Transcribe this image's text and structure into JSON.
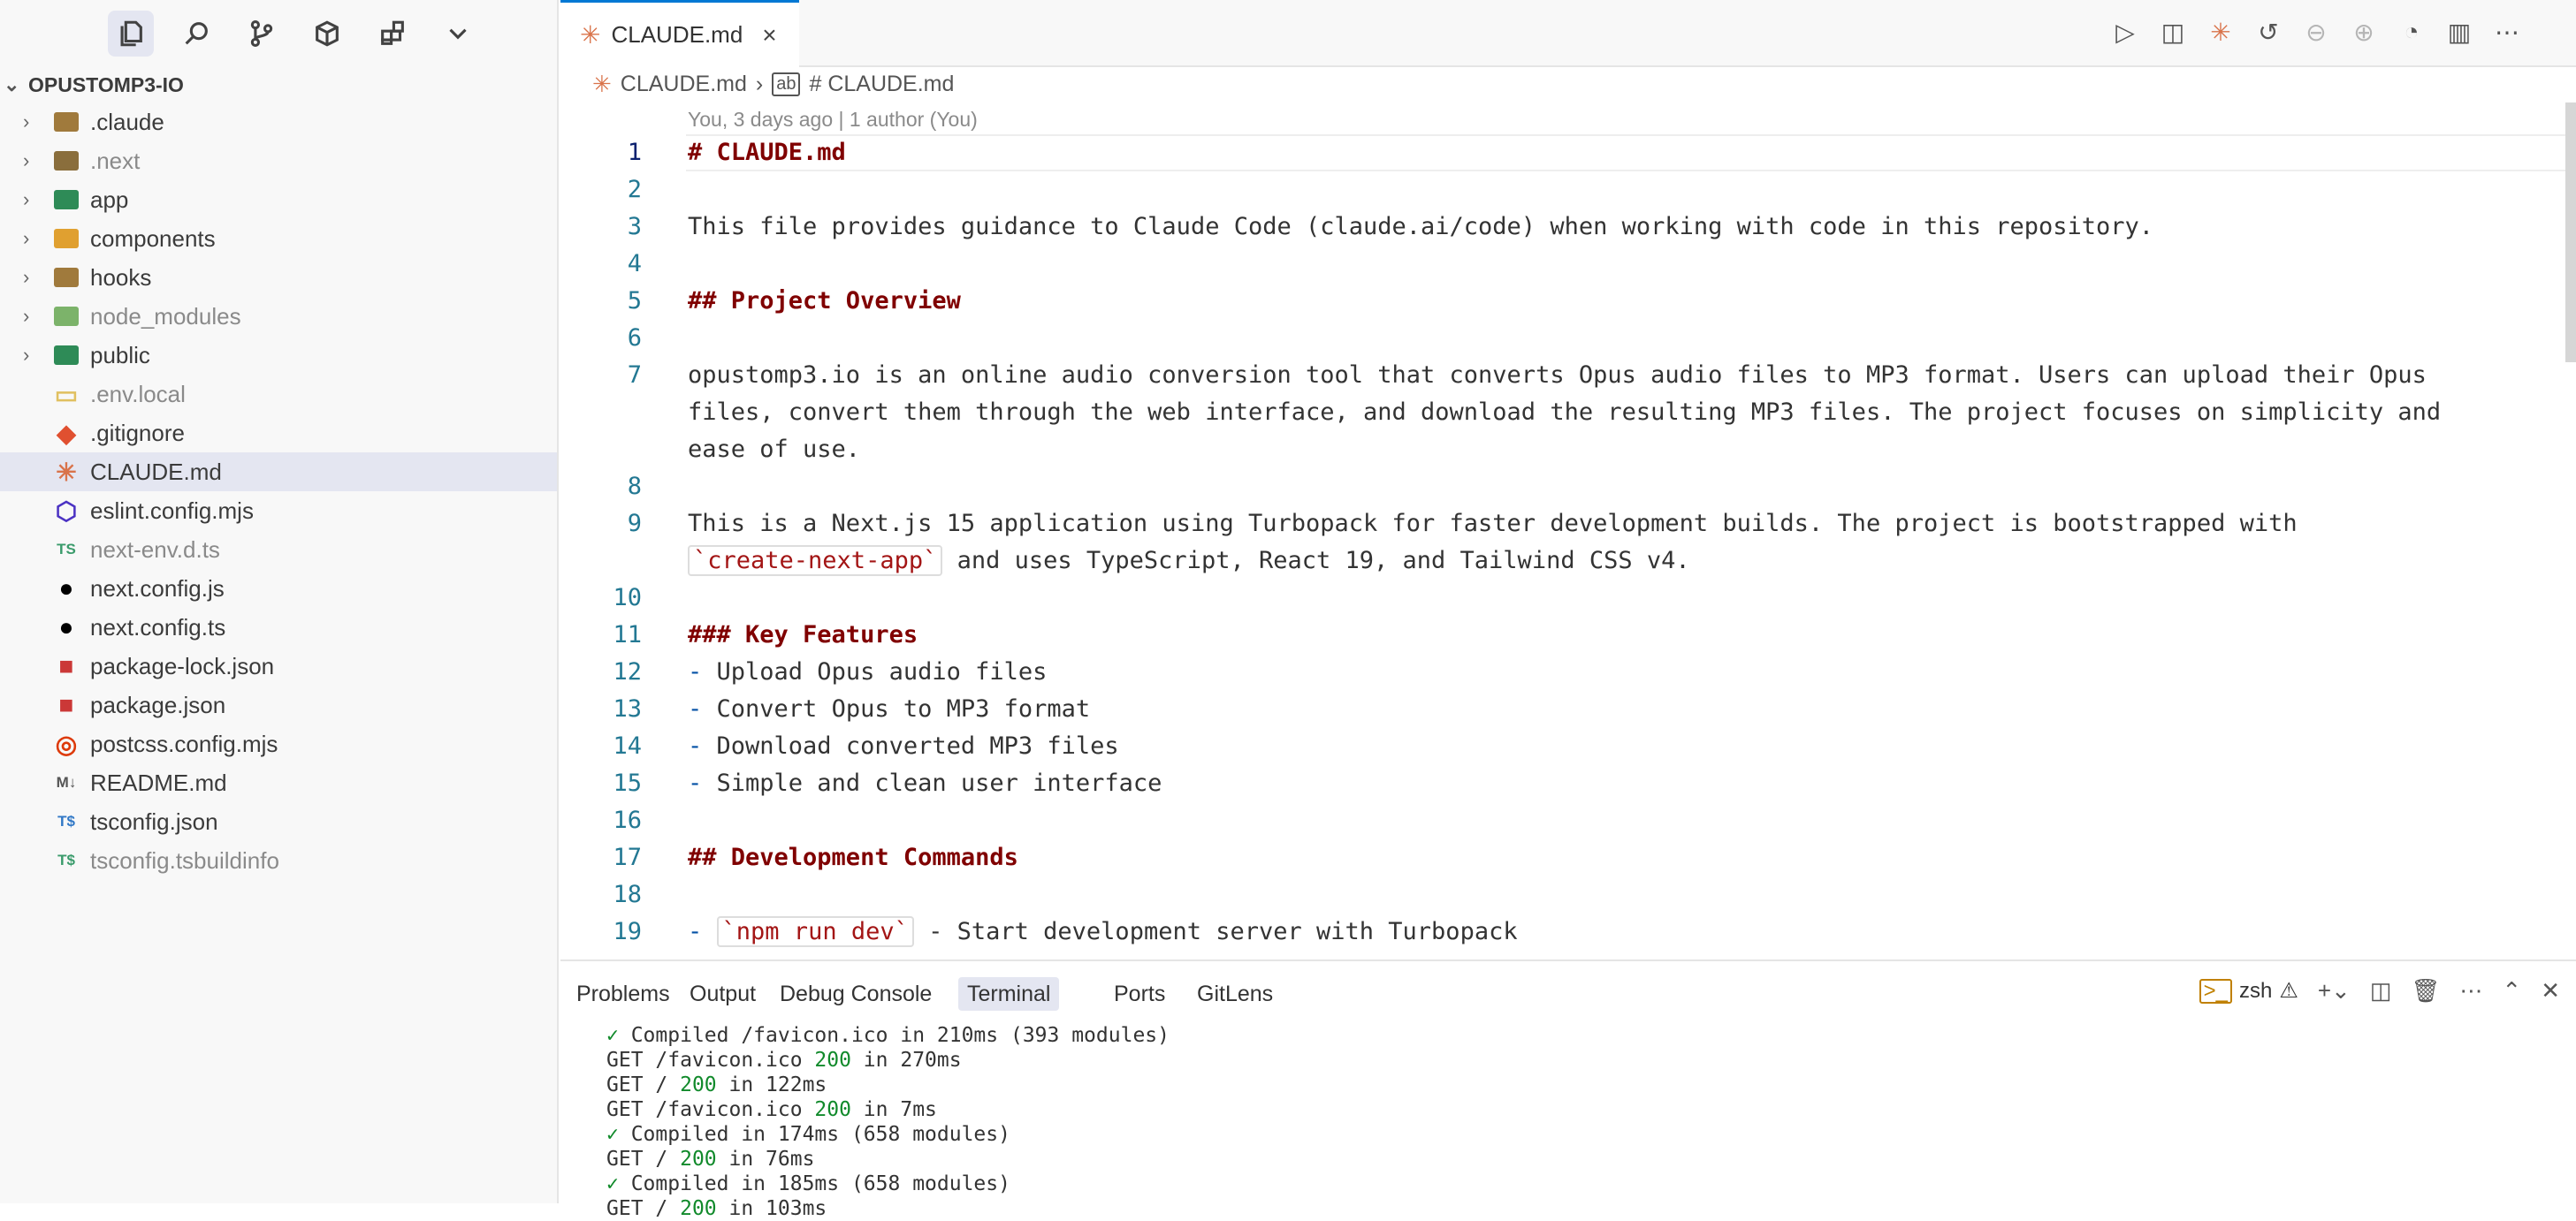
{
  "explorer": {
    "project": "OPUSTOMP3-IO",
    "items": [
      {
        "label": ".claude",
        "icon": "folder-claude-icon",
        "folder": true,
        "dim": false,
        "color": "#a07a3c"
      },
      {
        "label": ".next",
        "icon": "folder-next-icon",
        "folder": true,
        "dim": true,
        "color": "#8a6e3c"
      },
      {
        "label": "app",
        "icon": "folder-app-icon",
        "folder": true,
        "dim": false,
        "color": "#2e8b57"
      },
      {
        "label": "components",
        "icon": "folder-components-icon",
        "folder": true,
        "dim": false,
        "color": "#e0a030"
      },
      {
        "label": "hooks",
        "icon": "folder-hooks-icon",
        "folder": true,
        "dim": false,
        "color": "#a07a3c"
      },
      {
        "label": "node_modules",
        "icon": "folder-node-icon",
        "folder": true,
        "dim": true,
        "color": "#7cb36a"
      },
      {
        "label": "public",
        "icon": "folder-public-icon",
        "folder": true,
        "dim": false,
        "color": "#2e8b57"
      },
      {
        "label": ".env.local",
        "icon": "env-file-icon",
        "folder": false,
        "dim": true,
        "color": "#e0c060"
      },
      {
        "label": ".gitignore",
        "icon": "git-file-icon",
        "folder": false,
        "dim": false,
        "color": "#e05030"
      },
      {
        "label": "CLAUDE.md",
        "icon": "claude-file-icon",
        "folder": false,
        "dim": false,
        "color": "#d9734a"
      },
      {
        "label": "eslint.config.mjs",
        "icon": "eslint-file-icon",
        "folder": false,
        "dim": false,
        "color": "#4b32c3"
      },
      {
        "label": "next-env.d.ts",
        "icon": "ts-file-icon",
        "folder": false,
        "dim": true,
        "color": "#3a9b6b"
      },
      {
        "label": "next.config.js",
        "icon": "nextjs-file-icon",
        "folder": false,
        "dim": false,
        "color": "#000000"
      },
      {
        "label": "next.config.ts",
        "icon": "nextjs-file-icon",
        "folder": false,
        "dim": false,
        "color": "#000000"
      },
      {
        "label": "package-lock.json",
        "icon": "npm-file-icon",
        "folder": false,
        "dim": false,
        "color": "#cb3837"
      },
      {
        "label": "package.json",
        "icon": "npm-file-icon",
        "folder": false,
        "dim": false,
        "color": "#cb3837"
      },
      {
        "label": "postcss.config.mjs",
        "icon": "postcss-file-icon",
        "folder": false,
        "dim": false,
        "color": "#dd3a0a"
      },
      {
        "label": "README.md",
        "icon": "markdown-file-icon",
        "folder": false,
        "dim": false,
        "color": "#555555"
      },
      {
        "label": "tsconfig.json",
        "icon": "tsconfig-file-icon",
        "folder": false,
        "dim": false,
        "color": "#3178c6"
      },
      {
        "label": "tsconfig.tsbuildinfo",
        "icon": "tsconfig-file-icon",
        "folder": false,
        "dim": true,
        "color": "#3a9b6b"
      }
    ],
    "selected_index": 9
  },
  "tab": {
    "label": "CLAUDE.md",
    "close": "×"
  },
  "breadcrumb": {
    "file": "CLAUDE.md",
    "sep": "›",
    "symbol": "# CLAUDE.md"
  },
  "blame": "You, 3 days ago | 1 author (You)",
  "editor": {
    "lines": [
      {
        "n": "1",
        "html": "<span class=\"h\"># CLAUDE.md</span>"
      },
      {
        "n": "2",
        "html": ""
      },
      {
        "n": "3",
        "html": "This file provides guidance to Claude Code (claude.ai/code) when working with code in this repository."
      },
      {
        "n": "4",
        "html": ""
      },
      {
        "n": "5",
        "html": "<span class=\"h\">## Project Overview</span>"
      },
      {
        "n": "6",
        "html": ""
      },
      {
        "n": "7",
        "html": "opustomp3.io is an online audio conversion tool that converts Opus audio files to MP3 format. Users can upload their Opus"
      },
      {
        "n": "",
        "html": "files, convert them through the web interface, and download the resulting MP3 files. The project focuses on simplicity and"
      },
      {
        "n": "",
        "html": "ease of use."
      },
      {
        "n": "8",
        "html": ""
      },
      {
        "n": "9",
        "html": "This is a Next.js 15 application using Turbopack for faster development builds. The project is bootstrapped with"
      },
      {
        "n": "",
        "html": "<span class=\"inl\">`create-next-app`</span> and uses TypeScript, React 19, and Tailwind CSS v4."
      },
      {
        "n": "10",
        "html": ""
      },
      {
        "n": "11",
        "html": "<span class=\"h\">### Key Features</span>"
      },
      {
        "n": "12",
        "html": "<span class=\"bullet\">-</span> Upload Opus audio files"
      },
      {
        "n": "13",
        "html": "<span class=\"bullet\">-</span> Convert Opus to MP3 format"
      },
      {
        "n": "14",
        "html": "<span class=\"bullet\">-</span> Download converted MP3 files"
      },
      {
        "n": "15",
        "html": "<span class=\"bullet\">-</span> Simple and clean user interface"
      },
      {
        "n": "16",
        "html": ""
      },
      {
        "n": "17",
        "html": "<span class=\"h\">## Development Commands</span>"
      },
      {
        "n": "18",
        "html": ""
      },
      {
        "n": "19",
        "html": "<span class=\"bullet\">-</span> <span class=\"inl\">`npm run dev`</span> - Start development server with Turbopack"
      }
    ]
  },
  "panel": {
    "tabs": [
      "Problems",
      "Output",
      "Debug Console",
      "Terminal",
      "Ports",
      "GitLens"
    ],
    "active": "Terminal",
    "shell": "zsh",
    "terminal": [
      "<span class=\"ok\">✓</span> Compiled /favicon.ico in 210ms (393 modules)",
      "GET /favicon.ico <span class=\"num\">200</span> in 270ms",
      "GET / <span class=\"num\">200</span> in 122ms",
      "GET /favicon.ico <span class=\"num\">200</span> in 7ms",
      "<span class=\"ok\">✓</span> Compiled in 174ms (658 modules)",
      "GET / <span class=\"num\">200</span> in 76ms",
      "<span class=\"ok\">✓</span> Compiled in 185ms (658 modules)",
      "GET / <span class=\"num\">200</span> in 103ms"
    ]
  },
  "colors": {
    "accent": "#0078d4",
    "heading": "#800000",
    "line_number": "#237893"
  }
}
